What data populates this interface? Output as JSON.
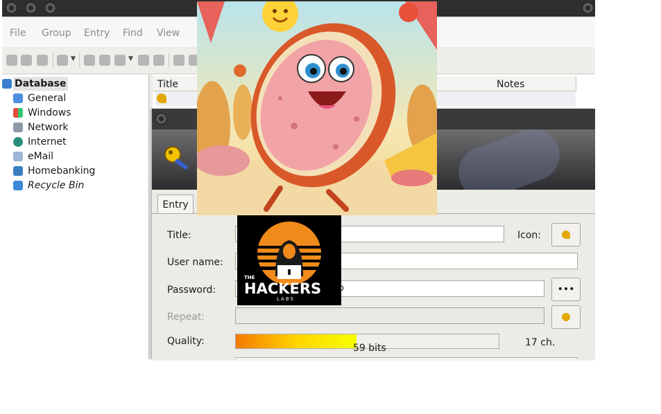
{
  "menu": [
    "File",
    "Group",
    "Entry",
    "Find",
    "View"
  ],
  "tree": {
    "root": "Database",
    "groups": [
      "General",
      "Windows",
      "Network",
      "Internet",
      "eMail",
      "Homebanking"
    ],
    "recycle": "Recycle Bin"
  },
  "list": {
    "columns": [
      "Title",
      "Notes"
    ]
  },
  "dialog": {
    "tab": "Entry",
    "labels": {
      "title": "Title:",
      "username": "User name:",
      "password": "Password:",
      "repeat": "Repeat:",
      "quality": "Quality:",
      "icon": "Icon:"
    },
    "password_tail": "o",
    "password_dots": "•••",
    "quality": {
      "bits_text": "59 bits",
      "chars_text": "17 ch.",
      "fill_fraction": 0.46
    }
  },
  "overlay": {
    "logo_line1": "THE",
    "logo_line2": "HACKERS",
    "logo_line3": "LABS"
  },
  "colors": {
    "accent_selection": "#eef0f4",
    "quality_start": "#f57a00",
    "quality_end": "#f6ff00",
    "logo_orange": "#f08a1a"
  }
}
